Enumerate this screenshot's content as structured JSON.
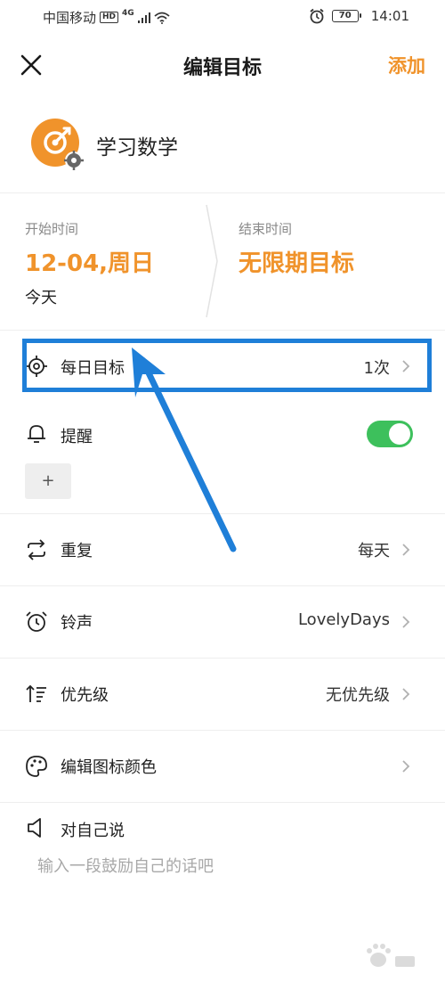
{
  "status_bar": {
    "carrier": "中国移动",
    "hd": "HD",
    "network": "4G",
    "battery": "70",
    "time": "14:01"
  },
  "header": {
    "title": "编辑目标",
    "add_label": "添加"
  },
  "goal": {
    "name": "学习数学"
  },
  "time": {
    "start_label": "开始时间",
    "start_date": "12-04,周日",
    "start_sub": "今天",
    "end_label": "结束时间",
    "end_value": "无限期目标"
  },
  "settings": {
    "daily_target_label": "每日目标",
    "daily_target_value": "1次",
    "reminder_label": "提醒",
    "reminder_enabled": true,
    "add_reminder_label": "+",
    "repeat_label": "重复",
    "repeat_value": "每天",
    "ringtone_label": "铃声",
    "ringtone_value": "LovelyDays",
    "priority_label": "优先级",
    "priority_value": "无优先级",
    "icon_color_label": "编辑图标颜色",
    "self_talk_label": "对自己说",
    "self_talk_placeholder": "输入一段鼓励自己的话吧"
  },
  "colors": {
    "accent": "#f0932b",
    "highlight": "#1f7fd8",
    "toggle_on": "#3dc05c"
  },
  "watermark": {
    "text": "Baidu 经验"
  }
}
